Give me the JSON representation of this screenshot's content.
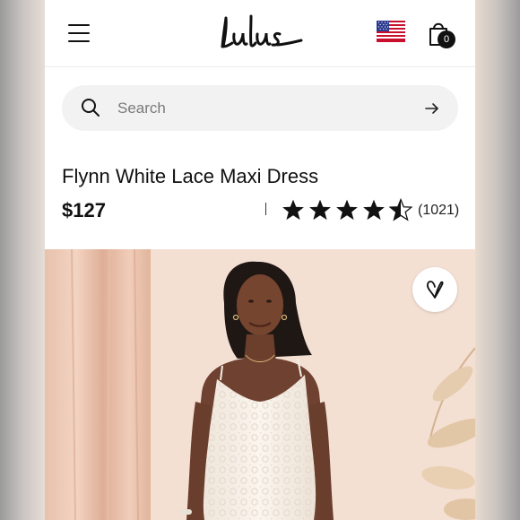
{
  "header": {
    "menu_icon": "hamburger-menu-icon",
    "brand": "Lulus",
    "flag_icon": "us-flag-icon",
    "cart_icon": "shopping-bag-icon",
    "cart_count": "0"
  },
  "search": {
    "placeholder": "Search",
    "icon": "search-icon",
    "submit_icon": "arrow-right-icon"
  },
  "product": {
    "title": "Flynn White Lace Maxi Dress",
    "price": "$127",
    "rating": 4.5,
    "rating_max": 5,
    "review_count": "(1021)"
  },
  "hero": {
    "favorite_icon": "heart-icon"
  },
  "colors": {
    "text": "#111111",
    "search_bg": "#f2f2f2",
    "backdrop": "#f3ddd1",
    "curtain": "#e6b9a0",
    "dress": "#f8f2ea"
  }
}
